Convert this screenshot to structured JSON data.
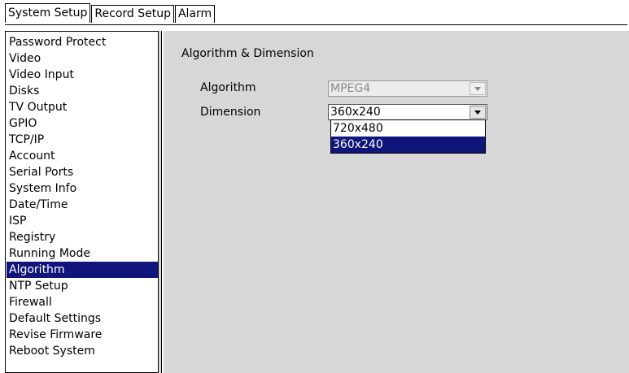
{
  "tabs": [
    {
      "label": "System Setup",
      "active": true
    },
    {
      "label": "Record Setup",
      "active": false
    },
    {
      "label": "Alarm",
      "active": false
    }
  ],
  "sidebar": {
    "items": [
      {
        "label": "Password Protect"
      },
      {
        "label": "Video"
      },
      {
        "label": "Video Input"
      },
      {
        "label": "Disks"
      },
      {
        "label": "TV Output"
      },
      {
        "label": "GPIO"
      },
      {
        "label": "TCP/IP"
      },
      {
        "label": "Account"
      },
      {
        "label": "Serial Ports"
      },
      {
        "label": "System Info"
      },
      {
        "label": "Date/Time"
      },
      {
        "label": "ISP"
      },
      {
        "label": "Registry"
      },
      {
        "label": "Running Mode"
      },
      {
        "label": "Algorithm",
        "selected": true
      },
      {
        "label": "NTP Setup"
      },
      {
        "label": "Firewall"
      },
      {
        "label": "Default Settings"
      },
      {
        "label": "Revise Firmware"
      },
      {
        "label": "Reboot System"
      }
    ]
  },
  "main": {
    "section_title": "Algorithm & Dimension",
    "algorithm": {
      "label": "Algorithm",
      "value": "MPEG4",
      "disabled": true
    },
    "dimension": {
      "label": "Dimension",
      "value": "360x240",
      "options": [
        "720x480",
        "360x240"
      ],
      "selected_index": 1,
      "open": true
    }
  },
  "colors": {
    "selection": "#10157c",
    "panel_bg": "#d7d7d7"
  },
  "icons": {
    "dropdown_arrow": "chevron-down-icon"
  }
}
